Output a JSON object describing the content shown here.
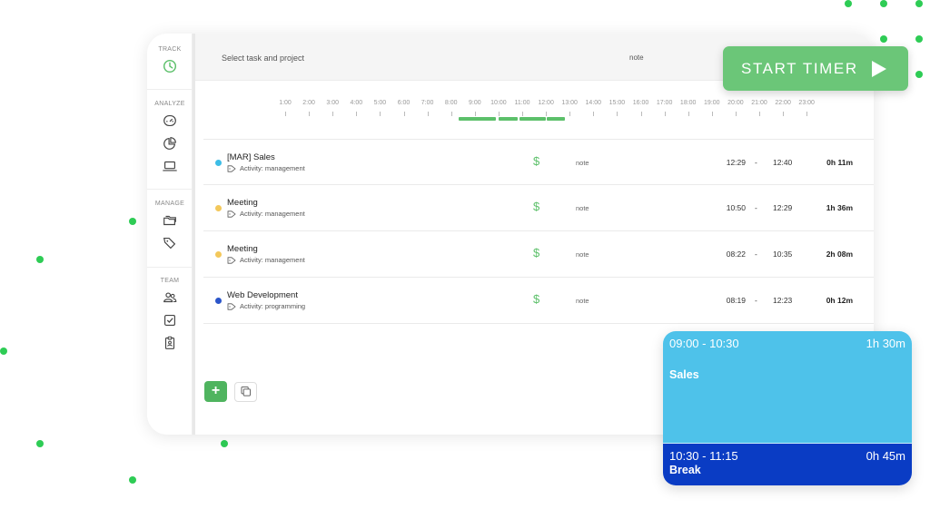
{
  "sidebar": {
    "sections": [
      {
        "label": "TRACK",
        "icons": [
          "clock-icon"
        ]
      },
      {
        "label": "ANALYZE",
        "icons": [
          "dashboard-icon",
          "pie-chart-icon",
          "laptop-icon"
        ]
      },
      {
        "label": "MANAGE",
        "icons": [
          "folders-icon",
          "tags-icon"
        ]
      },
      {
        "label": "TEAM",
        "icons": [
          "team-icon",
          "checkbox-icon",
          "clipboard-icon"
        ]
      }
    ],
    "active_color": "#5cc06a"
  },
  "topbar": {
    "task_placeholder": "Select task and project",
    "note_placeholder": "note"
  },
  "start_timer": {
    "label": "START TIMER",
    "icon": "play-icon",
    "color": "#6bc678"
  },
  "timeline": {
    "hours": [
      "1:00",
      "2:00",
      "3:00",
      "4:00",
      "5:00",
      "6:00",
      "7:00",
      "8:00",
      "9:00",
      "10:00",
      "11:00",
      "12:00",
      "13:00",
      "14:00",
      "15:00",
      "16:00",
      "17:00",
      "18:00",
      "19:00",
      "20:00",
      "21:00",
      "22:00",
      "23:00"
    ],
    "bar_color": "#5cc06a"
  },
  "entries": [
    {
      "title": "[MAR] Sales",
      "activity": "Activity: management",
      "dot_color": "#3dbde6",
      "billable": "$",
      "note": "note",
      "start": "12:29",
      "dash": "-",
      "end": "12:40",
      "duration": "0h 11m"
    },
    {
      "title": "Meeting",
      "activity": "Activity: management",
      "dot_color": "#f3c85b",
      "billable": "$",
      "note": "note",
      "start": "10:50",
      "dash": "-",
      "end": "12:29",
      "duration": "1h 36m"
    },
    {
      "title": "Meeting",
      "activity": "Activity: management",
      "dot_color": "#f3c85b",
      "billable": "$",
      "note": "note",
      "start": "08:22",
      "dash": "-",
      "end": "10:35",
      "duration": "2h 08m"
    },
    {
      "title": "Web Development",
      "activity": "Activity: programming",
      "dot_color": "#2b55c9",
      "billable": "$",
      "note": "note",
      "start": "08:19",
      "dash": "-",
      "end": "12:23",
      "duration": "0h 12m"
    }
  ],
  "actions": {
    "add_label": "+",
    "add_icon": "plus-icon",
    "copy_icon": "copy-icon"
  },
  "calendar_card": {
    "blocks": [
      {
        "time": "09:00 - 10:30",
        "duration": "1h 30m",
        "title": "Sales",
        "color": "#4ec2ea"
      },
      {
        "time": "10:30 - 11:15",
        "duration": "0h 45m",
        "title": "Break",
        "color": "#0a3cc4"
      }
    ]
  }
}
